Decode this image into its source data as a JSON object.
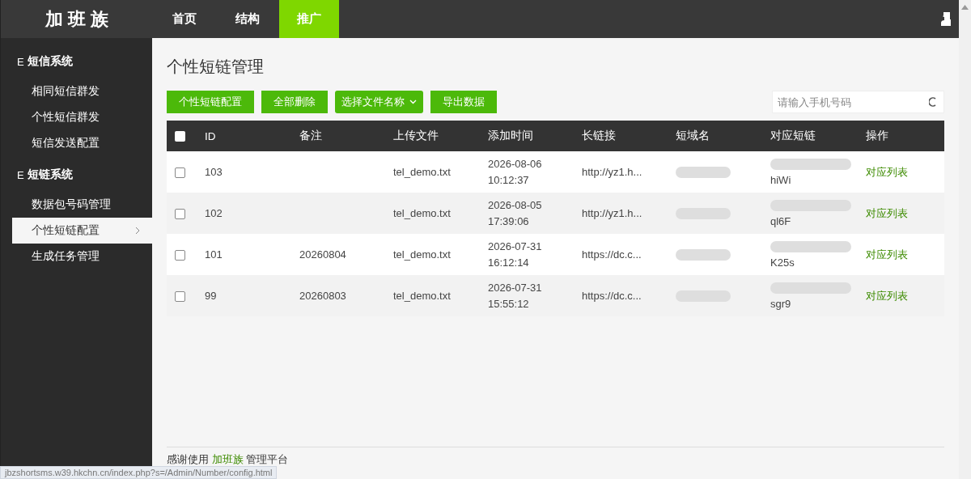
{
  "brand": "加 班 族",
  "nav": [
    {
      "label": "首页",
      "selected": false
    },
    {
      "label": "结构",
      "selected": false
    },
    {
      "label": "推广",
      "selected": true
    }
  ],
  "sidebar": {
    "groups": [
      {
        "icon_char": "E",
        "title": "短信系统",
        "items": [
          {
            "label": "相同短信群发",
            "selected": false
          },
          {
            "label": "个性短信群发",
            "selected": false
          },
          {
            "label": "短信发送配置",
            "selected": false
          }
        ]
      },
      {
        "icon_char": "E",
        "title": "短链系统",
        "items": [
          {
            "label": "数据包号码管理",
            "selected": false
          },
          {
            "label": "个性短链配置",
            "selected": true
          },
          {
            "label": "生成任务管理",
            "selected": false
          }
        ]
      }
    ]
  },
  "page_title": "个性短链管理",
  "toolbar": [
    {
      "label": "个性短链配置",
      "kind": "button"
    },
    {
      "label": "全部删除",
      "kind": "button"
    },
    {
      "label": "选择文件名称",
      "kind": "dropdown"
    },
    {
      "label": "导出数据",
      "kind": "button"
    }
  ],
  "search": {
    "placeholder": "请输入手机号码"
  },
  "table": {
    "all_checked": false,
    "columns": [
      "ID",
      "备注",
      "上传文件",
      "添加时间",
      "长链接",
      "短域名",
      "对应短链",
      "操作"
    ],
    "rows": [
      {
        "checked": false,
        "id": "103",
        "note": "",
        "file": "tel_demo.txt",
        "time": "2026-08-06 10:12:37",
        "long_link": "http://yz1.h...",
        "short_link": "hiWi",
        "action": "对应列表"
      },
      {
        "checked": false,
        "id": "102",
        "note": "",
        "file": "tel_demo.txt",
        "time": "2026-08-05 17:39:06",
        "long_link": "http://yz1.h...",
        "short_link": "ql6F",
        "action": "对应列表"
      },
      {
        "checked": false,
        "id": "101",
        "note": "20260804",
        "file": "tel_demo.txt",
        "time": "2026-07-31 16:12:14",
        "long_link": "https://dc.c...",
        "short_link": "K25s",
        "action": "对应列表"
      },
      {
        "checked": false,
        "id": "99",
        "note": "20260803",
        "file": "tel_demo.txt",
        "time": "2026-07-31 15:55:12",
        "long_link": "https://dc.c...",
        "short_link": "sgr9",
        "action": "对应列表"
      }
    ]
  },
  "footer": {
    "before": "感谢使用",
    "link": "加班族",
    "after": "管理平台"
  },
  "status_url": "jbzshortsms.w39.hkchn.cn/index.php?s=/Admin/Number/config.html"
}
